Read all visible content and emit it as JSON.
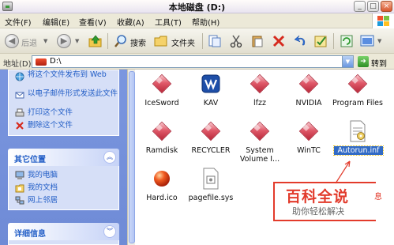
{
  "window": {
    "title": "本地磁盘 (D:)"
  },
  "menu": [
    "文件(F)",
    "编辑(E)",
    "查看(V)",
    "收藏(A)",
    "工具(T)",
    "帮助(H)"
  ],
  "toolbar": {
    "back_label": "后退",
    "search_label": "搜索",
    "folders_label": "文件夹"
  },
  "address": {
    "label": "地址(D)",
    "value": "D:\\",
    "go_label": "转到"
  },
  "tasks": [
    {
      "label": "将这个文件发布到 Web",
      "icon": "publish-web-icon"
    },
    {
      "label": "以电子邮件形式发送此文件",
      "icon": "email-icon"
    },
    {
      "label": "打印这个文件",
      "icon": "print-icon"
    },
    {
      "label": "删除这个文件",
      "icon": "delete-icon"
    }
  ],
  "other_places": {
    "title": "其它位置",
    "items": [
      {
        "label": "我的电脑",
        "icon": "my-computer-icon"
      },
      {
        "label": "我的文档",
        "icon": "my-documents-icon"
      },
      {
        "label": "网上邻居",
        "icon": "network-icon"
      }
    ]
  },
  "details": {
    "title": "详细信息"
  },
  "files": [
    {
      "name": "IceSword",
      "type": "folder"
    },
    {
      "name": "KAV",
      "type": "kav"
    },
    {
      "name": "lfzz",
      "type": "folder"
    },
    {
      "name": "NVIDIA",
      "type": "folder"
    },
    {
      "name": "Program Files",
      "type": "folder"
    },
    {
      "name": "Ramdisk",
      "type": "folder"
    },
    {
      "name": "RECYCLER",
      "type": "folder"
    },
    {
      "name": "System Volume I...",
      "type": "folder"
    },
    {
      "name": "WinTC",
      "type": "folder"
    },
    {
      "name": "Autorun.inf",
      "type": "inf",
      "selected": true
    },
    {
      "name": "Hard.ico",
      "type": "ico"
    },
    {
      "name": "pagefile.sys",
      "type": "sys"
    }
  ],
  "watermark": {
    "big": "百科全说",
    "small": "助你轻松解决",
    "side": "息"
  },
  "colors": {
    "accent": "#e23b2c",
    "panel_blue": "#7a96df",
    "link_blue": "#215dc6"
  }
}
